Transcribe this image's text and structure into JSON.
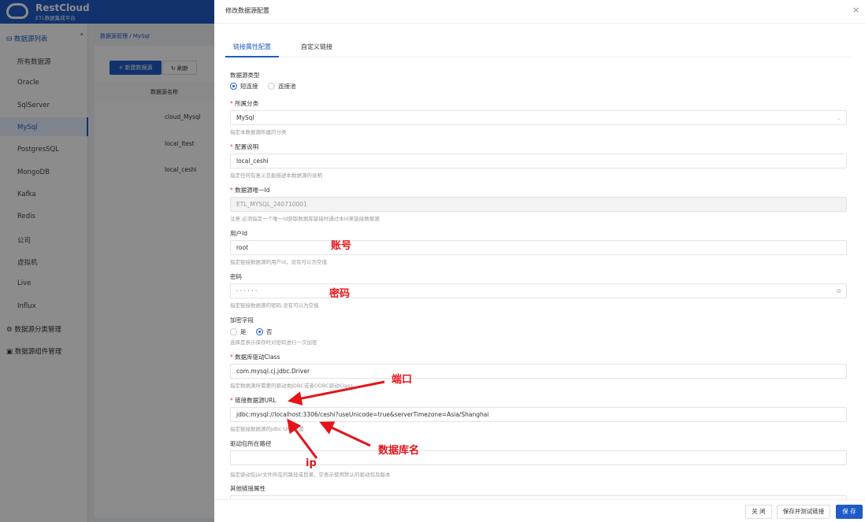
{
  "app": {
    "brand": "RestCloud",
    "subtitle": "ETL数据集成平台"
  },
  "sidebar": {
    "group": "数据源列表",
    "items": [
      "所有数据源",
      "Oracle",
      "SqlServer",
      "MySql",
      "PostgresSQL",
      "MongoDB",
      "Kafka",
      "Redis",
      "公司",
      "虚拟机",
      "Live",
      "Influx"
    ],
    "active": "MySql",
    "bottom": [
      "数据源分类管理",
      "数据源组件管理"
    ]
  },
  "main": {
    "breadcrumb": [
      "数据源管理",
      "MySql"
    ],
    "new_button": "+ 新建数据源",
    "refresh_button": "刷新",
    "column": "数据源名称",
    "rows": [
      "cloud_Mysql",
      "local_ltest",
      "local_ceshi"
    ]
  },
  "drawer": {
    "title": "修改数据源配置",
    "close": "×",
    "tabs": [
      "链接属性配置",
      "自定义链接"
    ],
    "type": {
      "label": "数据源类型",
      "options": [
        "短连接",
        "连接池"
      ],
      "selected": "短连接"
    },
    "category": {
      "label": "所属分类",
      "value": "MySql",
      "help": "指定本数据源所属的分类"
    },
    "desc": {
      "label": "配置说明",
      "value": "local_ceshi",
      "help": "指定任何有意义且能描述本数据源的说明"
    },
    "uid": {
      "label": "数据源唯一Id",
      "value": "ETL_MYSQL_240710001",
      "help": "注意:必须指定一个唯一Id获取数据库链接时通过本Id来链接数据源"
    },
    "user": {
      "label": "用户Id",
      "value": "root",
      "help": "指定链接数据源的用户Id，没有可以为空值"
    },
    "password": {
      "label": "密码",
      "value": "· · · · · ·",
      "help": "指定链接数据源的密码,没有可以为空值"
    },
    "encrypt": {
      "label": "加密字段",
      "options": [
        "是",
        "否"
      ],
      "selected": "否",
      "help": "选择是表示保存时对密码进行一次加密"
    },
    "driver": {
      "label": "数据库驱动Class",
      "value": "com.mysql.cj.jdbc.Driver",
      "help": "指定数据源所需要的驱动类JDBC或者ODBC驱动Class"
    },
    "url": {
      "label": "链接数据源URL",
      "value": "jdbc:mysql://localhost:3306/ceshi?useUnicode=true&serverTimezone=Asia/Shanghai",
      "help": "指定链接数据源的jdbc URL配置"
    },
    "jarpath": {
      "label": "驱动包所在路径",
      "value": "",
      "help": "指定驱动包jar文件所在的路径或目录，空表示使用默认的驱动包及版本"
    },
    "other": {
      "label": "其他链接属性"
    },
    "footer": {
      "close": "关 闭",
      "save_test": "保存并测试链接",
      "save": "保 存"
    }
  },
  "annotations": {
    "account": "账号",
    "password": "密码",
    "port": "端口",
    "dbname": "数据库名",
    "ip": "ip",
    "color": "#e5141a"
  }
}
